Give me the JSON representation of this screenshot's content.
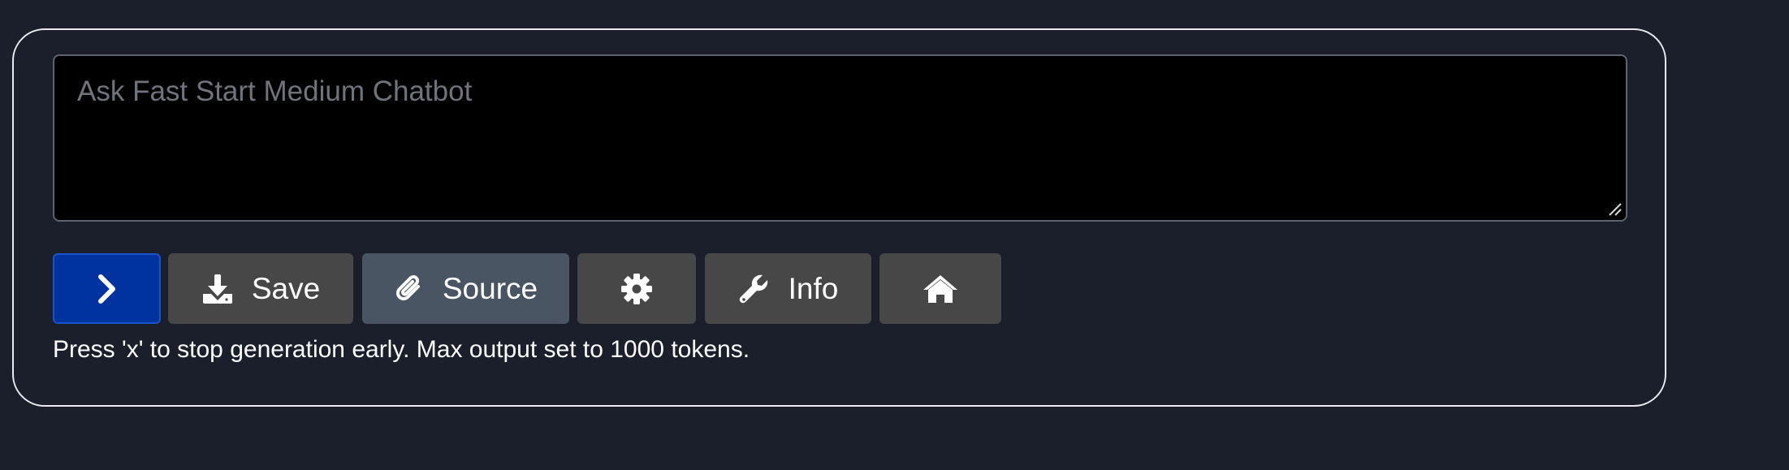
{
  "prompt": {
    "placeholder": "Ask Fast Start Medium Chatbot",
    "value": ""
  },
  "toolbar": {
    "send_icon": "chevron-right-icon",
    "save_label": "Save",
    "save_icon": "download-icon",
    "source_label": "Source",
    "source_icon": "paperclip-icon",
    "settings_icon": "gear-icon",
    "info_label": "Info",
    "info_icon": "wrench-icon",
    "home_icon": "home-icon"
  },
  "status": {
    "message": "Press 'x' to stop generation early. Max output set to 1000 tokens."
  },
  "colors": {
    "page_background": "#1b1f2c",
    "send_button": "#0032a0",
    "default_button": "#474747",
    "source_button": "#4a5564",
    "prompt_background": "#000000"
  }
}
